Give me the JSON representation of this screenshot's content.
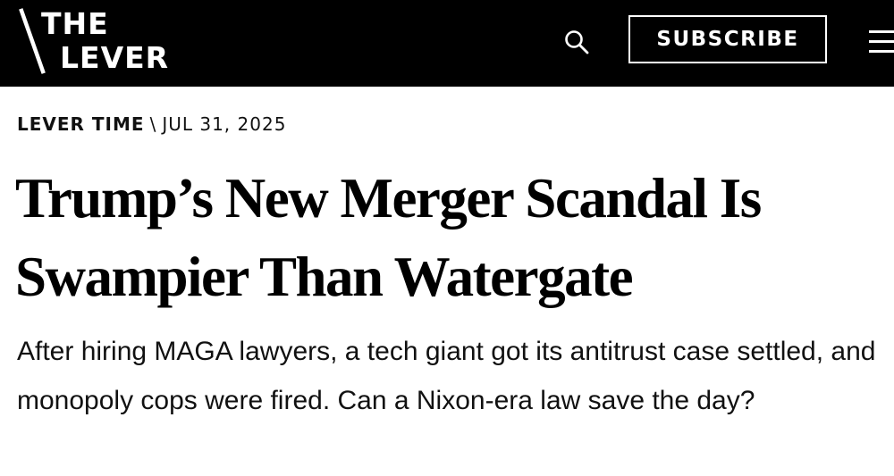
{
  "header": {
    "logo": {
      "line1": "THE",
      "line2": "LEVER"
    },
    "search_icon": "search-icon",
    "subscribe_label": "SUBSCRIBE",
    "menu_icon": "hamburger-menu-icon",
    "background_color": "#000000",
    "foreground_color": "#ffffff"
  },
  "article": {
    "section": "LEVER TIME",
    "separator": "\\",
    "date": "JUL 31, 2025",
    "headline": "Trump’s New Merger Scandal Is Swampier Than Watergate",
    "dek": "After hiring MAGA lawyers, a tech giant got its antitrust case settled, and monopoly cops were fired. Can a Nixon-era law save the day?"
  }
}
